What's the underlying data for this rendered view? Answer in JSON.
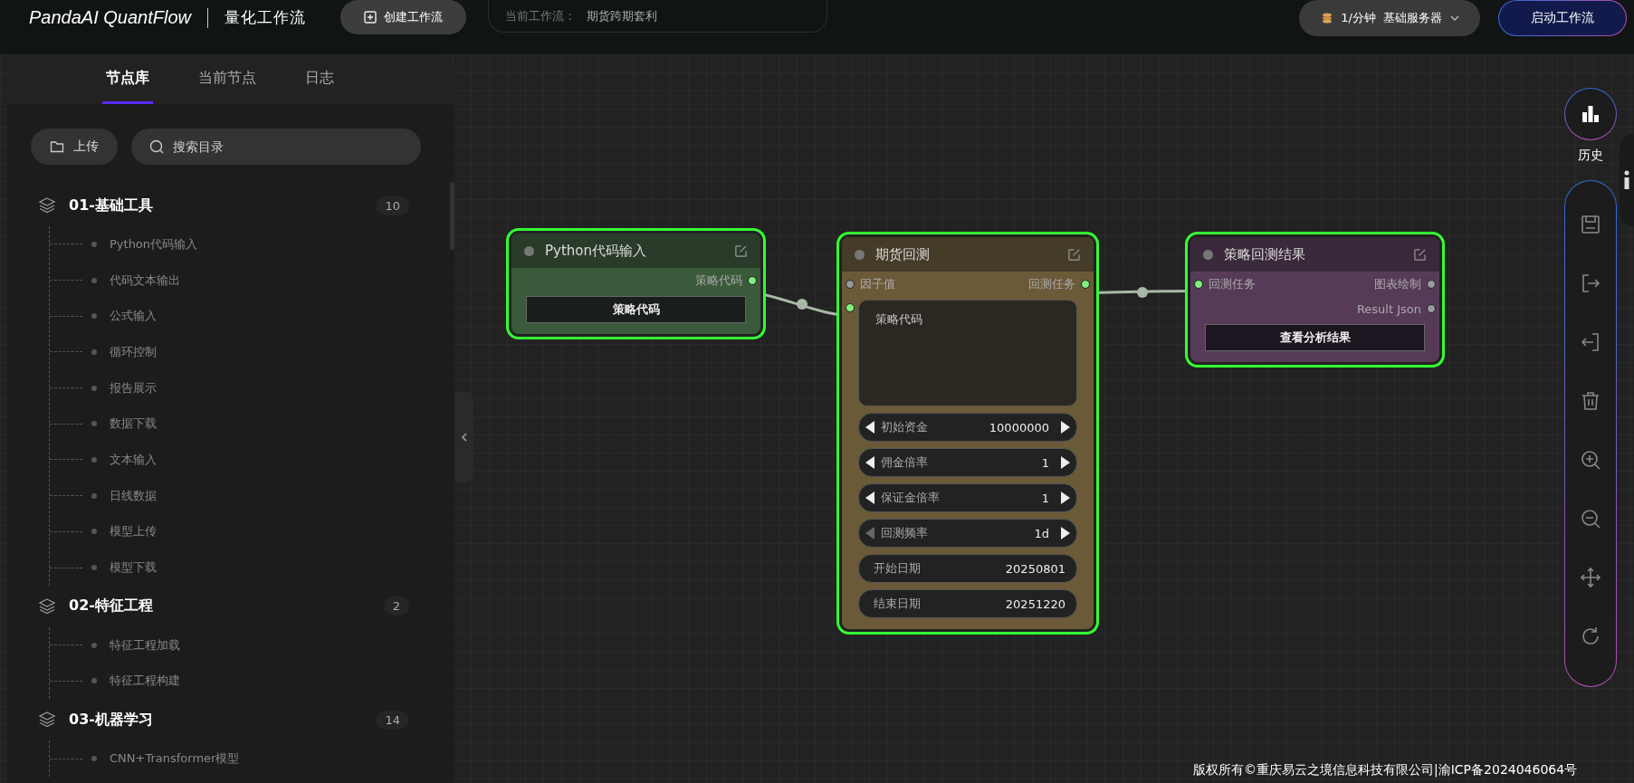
{
  "header": {
    "logo": "PandaAI QuantFlow",
    "title": "量化工作流",
    "create_button": "创建工作流",
    "current_label": "当前工作流：",
    "current_value": "期货跨期套利",
    "rate": "1/分钟",
    "server": "基础服务器",
    "start_button": "启动工作流"
  },
  "sidebar": {
    "tabs": [
      {
        "label": "节点库",
        "selected": true
      },
      {
        "label": "当前节点",
        "selected": false
      },
      {
        "label": "日志",
        "selected": false
      }
    ],
    "upload_button": "上传",
    "search": {
      "placeholder": "搜索目录"
    },
    "categories": [
      {
        "title": "01-基础工具",
        "count": "10",
        "children": [
          {
            "label": "Python代码输入"
          },
          {
            "label": "代码文本输出"
          },
          {
            "label": "公式输入"
          },
          {
            "label": "循环控制"
          },
          {
            "label": "报告展示"
          },
          {
            "label": "数据下载"
          },
          {
            "label": "文本输入"
          },
          {
            "label": "日线数据"
          },
          {
            "label": "模型上传"
          },
          {
            "label": "模型下载"
          }
        ]
      },
      {
        "title": "02-特征工程",
        "count": "2",
        "children": [
          {
            "label": "特征工程加载"
          },
          {
            "label": "特征工程构建"
          }
        ]
      },
      {
        "title": "03-机器学习",
        "count": "14",
        "children": [
          {
            "label": "CNN+Transformer模型"
          }
        ]
      }
    ]
  },
  "nodes": [
    {
      "title": "Python代码输入",
      "color": "#3b5a3b",
      "selected": true,
      "ports": [
        {
          "right": {
            "label": "策略代码",
            "connected": true
          }
        }
      ],
      "widgets": [
        {
          "kind": "button",
          "label": "策略代码"
        }
      ]
    },
    {
      "title": "期货回测",
      "color": "#6b5a38",
      "selected": true,
      "ports": [
        {
          "left": {
            "label": "因子值",
            "connected": false
          },
          "right": {
            "label": "回测任务",
            "connected": true
          }
        }
      ],
      "widgets": [
        {
          "kind": "textarea",
          "value": "策略代码",
          "connected": true
        },
        {
          "kind": "number",
          "label": "初始资金",
          "value": "10000000",
          "left_disabled": false
        },
        {
          "kind": "number",
          "label": "佣金倍率",
          "value": "1",
          "left_disabled": false
        },
        {
          "kind": "number",
          "label": "保证金倍率",
          "value": "1",
          "left_disabled": false
        },
        {
          "kind": "number",
          "label": "回测频率",
          "value": "1d",
          "left_disabled": true
        },
        {
          "kind": "text",
          "label": "开始日期",
          "value": "20250801"
        },
        {
          "kind": "text",
          "label": "结束日期",
          "value": "20251220"
        }
      ]
    },
    {
      "title": "策略回测结果",
      "color": "#573a58",
      "selected": true,
      "ports": [
        {
          "left": {
            "label": "回测任务",
            "connected": true
          },
          "right": {
            "label": "图表绘制",
            "connected": false
          }
        },
        {
          "right": {
            "label": "Result Json",
            "connected": false
          }
        }
      ],
      "widgets": [
        {
          "kind": "button",
          "label": "查看分析结果"
        }
      ]
    }
  ],
  "toolbar": {
    "history": "历史"
  },
  "footer": "版权所有©重庆易云之境信息科技有限公司|渝ICP备2024046064号"
}
